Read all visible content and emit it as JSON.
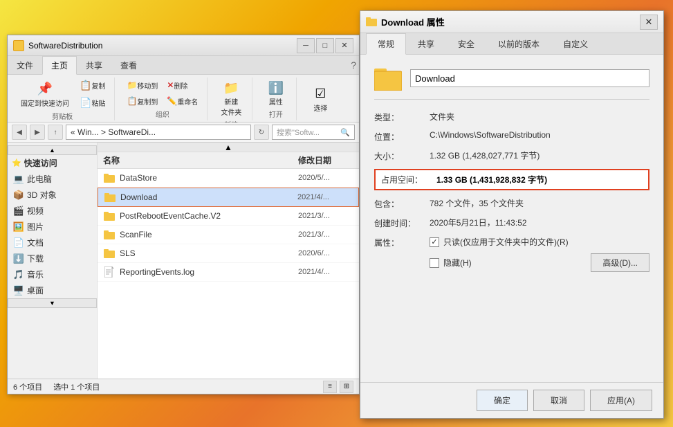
{
  "background": {
    "color1": "#f5e642",
    "color2": "#f0a500",
    "color3": "#e8732a"
  },
  "explorer": {
    "title": "SoftwareDistribution",
    "ribbon_tabs": [
      "文件",
      "主页",
      "共享",
      "查看"
    ],
    "active_tab": "主页",
    "ribbon_groups": {
      "clipboard": {
        "label": "剪贴板",
        "buttons": [
          "固定到快速访问",
          "复制",
          "粘贴"
        ]
      },
      "organize": {
        "label": "组织",
        "buttons": [
          "移动到",
          "复制到",
          "删除",
          "重命名"
        ]
      },
      "new": {
        "label": "新建",
        "buttons": [
          "新建文件夹"
        ]
      },
      "open": {
        "label": "打开",
        "buttons": [
          "属性"
        ]
      },
      "select": {
        "label": "",
        "buttons": [
          "选择"
        ]
      }
    },
    "address": {
      "breadcrumb": "« Win... > SoftwareDi...",
      "search_placeholder": "搜索\"Softw..."
    },
    "sidebar": [
      {
        "label": "快速访问",
        "icon": "⭐",
        "type": "section"
      },
      {
        "label": "此电脑",
        "icon": "💻",
        "type": "item"
      },
      {
        "label": "3D 对象",
        "icon": "📦",
        "type": "item"
      },
      {
        "label": "视频",
        "icon": "🎬",
        "type": "item"
      },
      {
        "label": "图片",
        "icon": "🖼️",
        "type": "item"
      },
      {
        "label": "文档",
        "icon": "📄",
        "type": "item"
      },
      {
        "label": "下载",
        "icon": "⬇️",
        "type": "item"
      },
      {
        "label": "音乐",
        "icon": "🎵",
        "type": "item"
      },
      {
        "label": "桌面",
        "icon": "🖥️",
        "type": "item"
      }
    ],
    "files": [
      {
        "name": "DataStore",
        "type": "folder",
        "date": "2020/5/...",
        "selected": false
      },
      {
        "name": "Download",
        "type": "folder",
        "date": "2021/4/...",
        "selected": true
      },
      {
        "name": "PostRebootEventCache.V2",
        "type": "folder",
        "date": "2021/3/...",
        "selected": false
      },
      {
        "name": "ScanFile",
        "type": "folder",
        "date": "2021/3/...",
        "selected": false
      },
      {
        "name": "SLS",
        "type": "folder",
        "date": "2020/6/...",
        "selected": false
      },
      {
        "name": "ReportingEvents.log",
        "type": "file",
        "date": "2021/4/...",
        "selected": false
      }
    ],
    "columns": {
      "name": "名称",
      "date": "修改日期"
    },
    "status": {
      "count": "6 个项目",
      "selected": "选中 1 个项目"
    }
  },
  "properties_dialog": {
    "title": "Download 属性",
    "tabs": [
      "常规",
      "共享",
      "安全",
      "以前的版本",
      "自定义"
    ],
    "active_tab": "常规",
    "folder_name": "Download",
    "type_label": "类型：",
    "type_value": "文件夹",
    "location_label": "位置：",
    "location_value": "C:\\Windows\\SoftwareDistribution",
    "size_label": "大小：",
    "size_value": "1.32 GB (1,428,027,771 字节)",
    "disk_size_label": "占用空间：",
    "disk_size_value": "1.33 GB (1,431,928,832 字节)",
    "contains_label": "包含：",
    "contains_value": "782 个文件，35 个文件夹",
    "created_label": "创建时间：",
    "created_value": "2020年5月21日，11:43:52",
    "attr_label": "属性：",
    "attr_readonly": "■只读(仅应用于文件夹中的文件)(R)",
    "attr_hidden": "□隐藏(H)",
    "advanced_btn": "高级(D)...",
    "ok_btn": "确定",
    "cancel_btn": "取消",
    "apply_btn": "应用(A)"
  }
}
